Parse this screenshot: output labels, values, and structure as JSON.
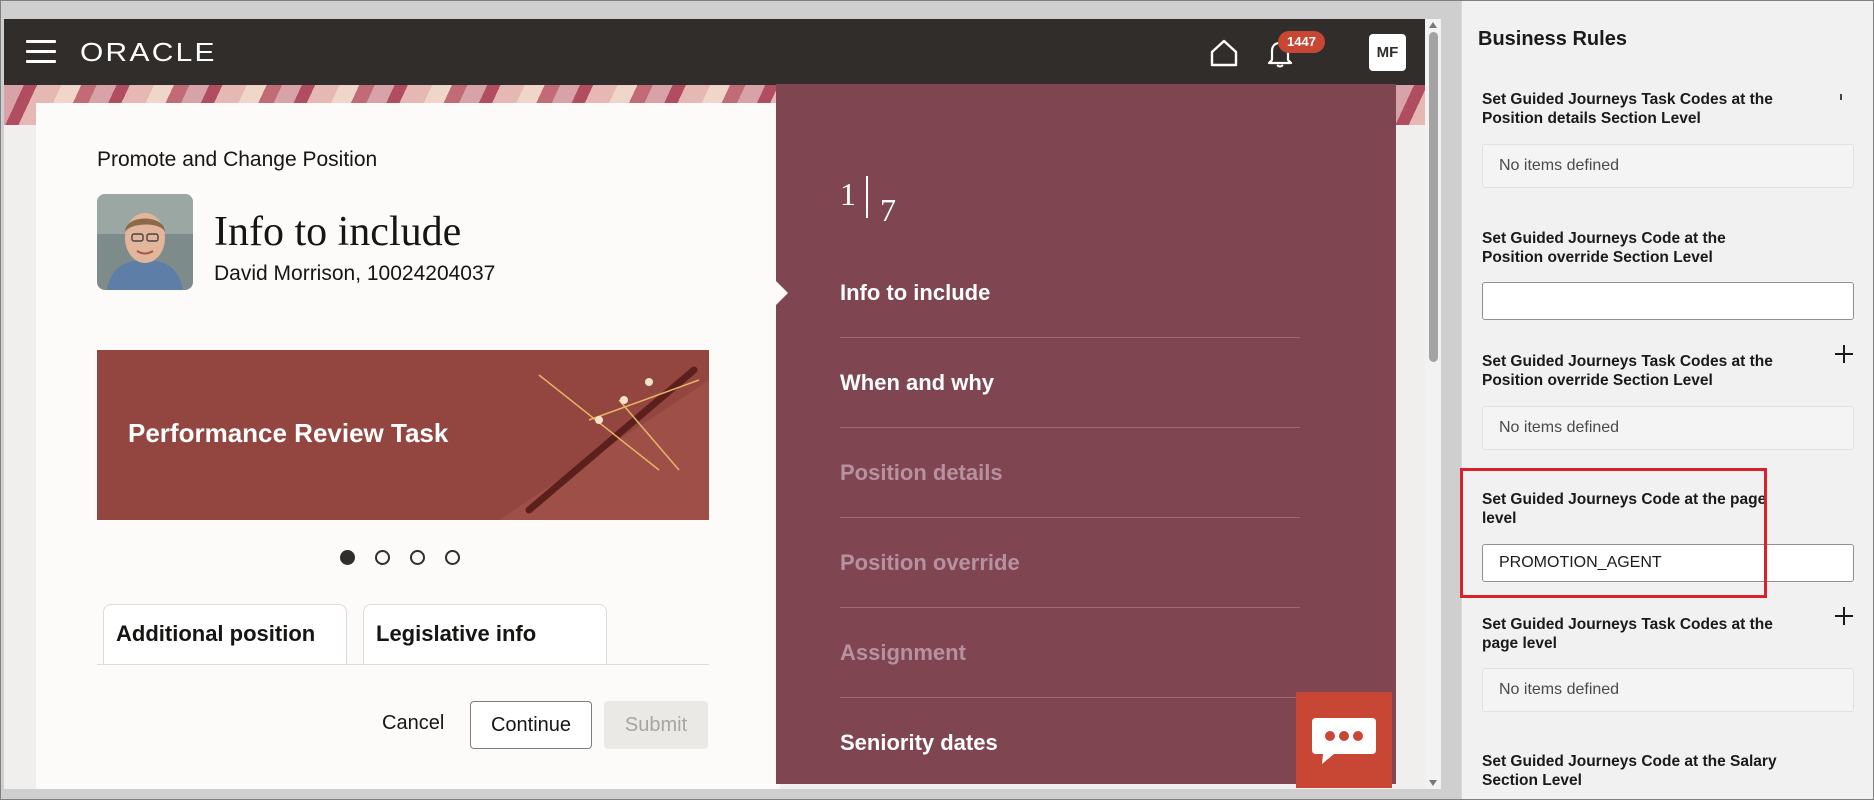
{
  "header": {
    "logo": "ORACLE",
    "notification_count": "1447",
    "user_initials": "MF"
  },
  "page": {
    "app_title": "Promote and Change Position",
    "heading": "Info to include",
    "person": "David Morrison, 10024204037"
  },
  "promo": {
    "title": "Performance Review Task",
    "slides": 4,
    "active_slide": 1
  },
  "sub_cards": [
    "Additional position",
    "Legislative info"
  ],
  "actions": {
    "cancel": "Cancel",
    "continue": "Continue",
    "submit": "Submit"
  },
  "steps": {
    "current": "1",
    "total": "7",
    "items": [
      {
        "label": "Info to include",
        "state": "enabled"
      },
      {
        "label": "When and why",
        "state": "enabled"
      },
      {
        "label": "Position details",
        "state": "disabled"
      },
      {
        "label": "Position override",
        "state": "disabled"
      },
      {
        "label": "Assignment",
        "state": "disabled"
      },
      {
        "label": "Seniority dates",
        "state": "enabled"
      }
    ]
  },
  "business_rules": {
    "title": "Business Rules",
    "r1_label": "Set Guided Journeys Task Codes at the Position details Section Level",
    "r1_value": "No items defined",
    "r2_label": "Set Guided Journeys Code at the Position override Section Level",
    "r2_value": "",
    "r3_label": "Set Guided Journeys Task Codes at the Position override Section Level",
    "r3_value": "No items defined",
    "r4_label": "Set Guided Journeys Code at the page level",
    "r4_value": "PROMOTION_AGENT",
    "r5_label": "Set Guided Journeys Task Codes at the page level",
    "r5_value": "No items defined",
    "r6_label": "Set Guided Journeys Code at the Salary Section Level"
  },
  "colors": {
    "topbar": "#312d2a",
    "steps_panel": "#7f4651",
    "promo": "#93463f",
    "accent_red": "#c74634",
    "highlight": "#d7232b"
  },
  "icons": [
    "hamburger-icon",
    "home-icon",
    "bell-icon",
    "chat-icon",
    "plus-icon"
  ]
}
